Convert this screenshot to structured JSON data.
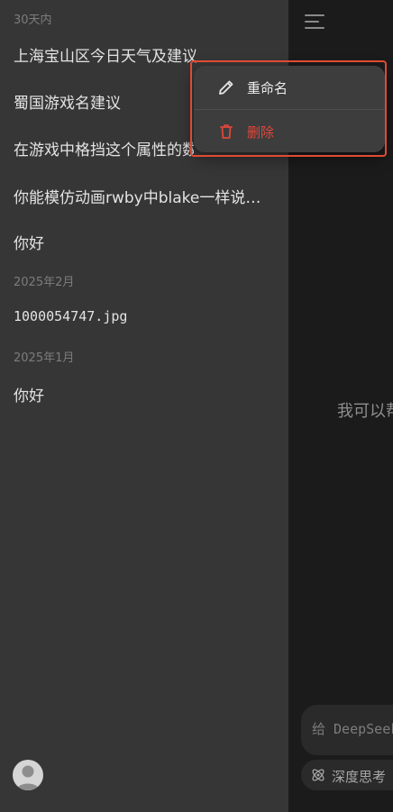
{
  "main": {
    "greeting_partial": "我可以帮",
    "composer_placeholder": "给 DeepSeek",
    "think_button_label": "深度思考"
  },
  "sidebar": {
    "sections": [
      {
        "label": "30天内",
        "items": [
          "上海宝山区今日天气及建议",
          "蜀国游戏名建议",
          "在游戏中格挡这个属性的数值",
          "你能模仿动画rwby中blake一样说…",
          "你好"
        ]
      },
      {
        "label": "2025年2月",
        "items": [
          "1000054747.jpg"
        ]
      },
      {
        "label": "2025年1月",
        "items": [
          "你好"
        ]
      }
    ]
  },
  "context_menu": {
    "rename_label": "重命名",
    "delete_label": "删除",
    "delete_color": "#e0473a"
  },
  "colors": {
    "sidebar_bg": "#363637",
    "highlight_border": "#e04b33"
  }
}
